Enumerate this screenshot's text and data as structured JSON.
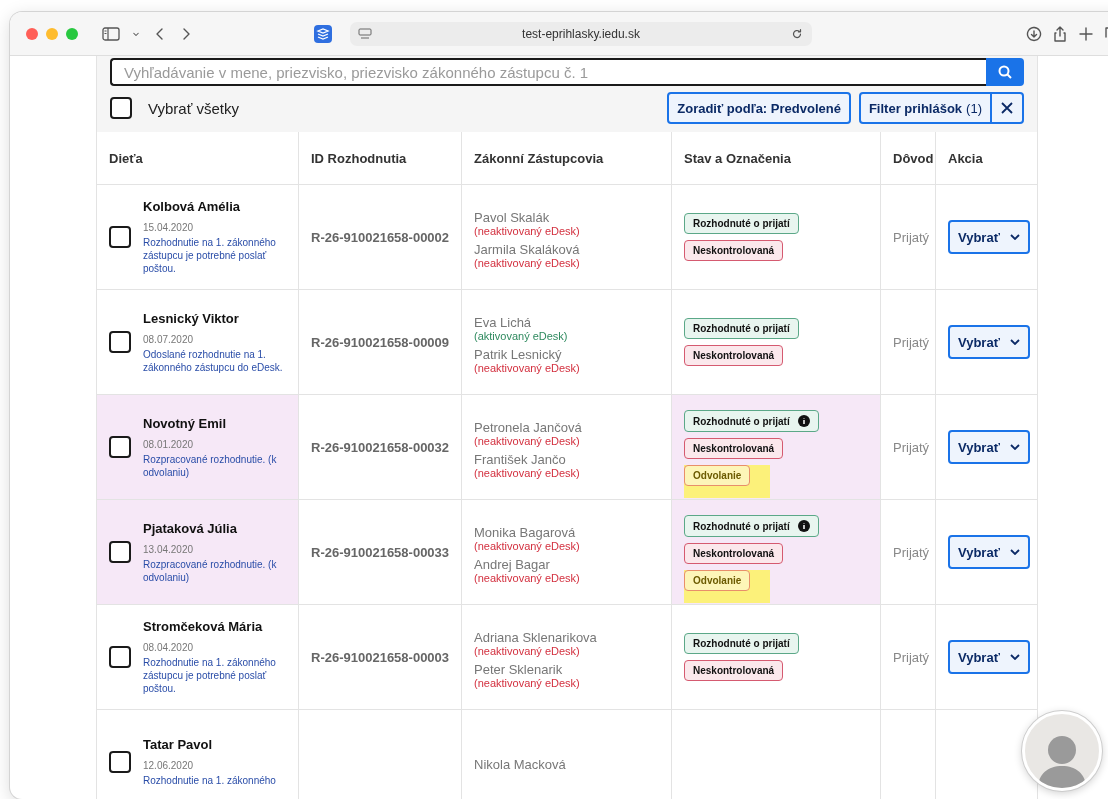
{
  "browser": {
    "url": "test-eprihlasky.iedu.sk"
  },
  "search": {
    "placeholder": "Vyhľadávanie v mene, priezvisko, priezvisko zákonného zástupcu č. 1"
  },
  "select_all": {
    "label": "Vybrať všetky",
    "checked": false
  },
  "sort_button": {
    "label": "Zoradiť podľa: Predvolené"
  },
  "filter_button": {
    "label": "Filter prihlášok",
    "count": "(1)"
  },
  "table": {
    "columns": [
      "Dieťa",
      "ID Rozhodnutia",
      "Zákonní Zástupcovia",
      "Stav a Označenia",
      "Dôvod",
      "Akcia"
    ],
    "rows": [
      {
        "selected": false,
        "highlighted": false,
        "name": "Kolbová Amélia",
        "date": "15.04.2020",
        "note": "Rozhodnutie na 1. zákonného zástupcu je potrebné poslať poštou.",
        "decision_id": "R-26-910021658-00002",
        "guardians": [
          {
            "name": "Pavol Skalák",
            "edesk": "(neaktivovaný eDesk)",
            "active": false
          },
          {
            "name": "Jarmila Skaláková",
            "edesk": "(neaktivovaný eDesk)",
            "active": false
          }
        ],
        "badges": [
          {
            "label": "Rozhodnuté o prijatí",
            "kind": "decision",
            "info": false,
            "marked": false
          },
          {
            "label": "Neskontrolovaná",
            "kind": "unchecked",
            "info": false,
            "marked": false
          }
        ],
        "reason": "Prijatý",
        "action": "Vybrať"
      },
      {
        "selected": false,
        "highlighted": false,
        "name": "Lesnický Viktor",
        "date": "08.07.2020",
        "note": "Odoslané rozhodnutie na 1. zákonného zástupcu do eDesk.",
        "decision_id": "R-26-910021658-00009",
        "guardians": [
          {
            "name": "Eva Lichá",
            "edesk": "(aktivovaný eDesk)",
            "active": true
          },
          {
            "name": "Patrik Lesnický",
            "edesk": "(neaktivovaný eDesk)",
            "active": false
          }
        ],
        "badges": [
          {
            "label": "Rozhodnuté o prijatí",
            "kind": "decision",
            "info": false,
            "marked": false
          },
          {
            "label": "Neskontrolovaná",
            "kind": "unchecked",
            "info": false,
            "marked": false
          }
        ],
        "reason": "Prijatý",
        "action": "Vybrať"
      },
      {
        "selected": false,
        "highlighted": true,
        "name": "Novotný Emil",
        "date": "08.01.2020",
        "note": "Rozpracované rozhodnutie. (k odvolaniu)",
        "decision_id": "R-26-910021658-00032",
        "guardians": [
          {
            "name": "Petronela Jančová",
            "edesk": "(neaktivovaný eDesk)",
            "active": false
          },
          {
            "name": "František Jančo",
            "edesk": "(neaktivovaný eDesk)",
            "active": false
          }
        ],
        "badges": [
          {
            "label": "Rozhodnuté o prijatí",
            "kind": "decision",
            "info": true,
            "marked": false
          },
          {
            "label": "Neskontrolovaná",
            "kind": "unchecked",
            "info": false,
            "marked": false
          },
          {
            "label": "Odvolanie",
            "kind": "appeal",
            "info": false,
            "marked": true
          }
        ],
        "reason": "Prijatý",
        "action": "Vybrať"
      },
      {
        "selected": false,
        "highlighted": true,
        "name": "Pjataková Júlia",
        "date": "13.04.2020",
        "note": "Rozpracované rozhodnutie. (k odvolaniu)",
        "decision_id": "R-26-910021658-00033",
        "guardians": [
          {
            "name": "Monika Bagarová",
            "edesk": "(neaktivovaný eDesk)",
            "active": false
          },
          {
            "name": "Andrej Bagar",
            "edesk": "(neaktivovaný eDesk)",
            "active": false
          }
        ],
        "badges": [
          {
            "label": "Rozhodnuté o prijatí",
            "kind": "decision",
            "info": true,
            "marked": false
          },
          {
            "label": "Neskontrolovaná",
            "kind": "unchecked",
            "info": false,
            "marked": false
          },
          {
            "label": "Odvolanie",
            "kind": "appeal",
            "info": false,
            "marked": true
          }
        ],
        "reason": "Prijatý",
        "action": "Vybrať"
      },
      {
        "selected": false,
        "highlighted": false,
        "name": "Stromčeková Mária",
        "date": "08.04.2020",
        "note": "Rozhodnutie na 1. zákonného zástupcu je potrebné poslať poštou.",
        "decision_id": "R-26-910021658-00003",
        "guardians": [
          {
            "name": "Adriana Sklenarikova",
            "edesk": "(neaktivovaný eDesk)",
            "active": false
          },
          {
            "name": "Peter Sklenarik",
            "edesk": "(neaktivovaný eDesk)",
            "active": false
          }
        ],
        "badges": [
          {
            "label": "Rozhodnuté o prijatí",
            "kind": "decision",
            "info": false,
            "marked": false
          },
          {
            "label": "Neskontrolovaná",
            "kind": "unchecked",
            "info": false,
            "marked": false
          }
        ],
        "reason": "Prijatý",
        "action": "Vybrať"
      },
      {
        "selected": false,
        "highlighted": false,
        "name": "Tatar Pavol",
        "date": "12.06.2020",
        "note": "Rozhodnutie na 1. zákonného",
        "guardians": [
          {
            "name": "Nikola Macková"
          }
        ],
        "badges": []
      }
    ]
  }
}
